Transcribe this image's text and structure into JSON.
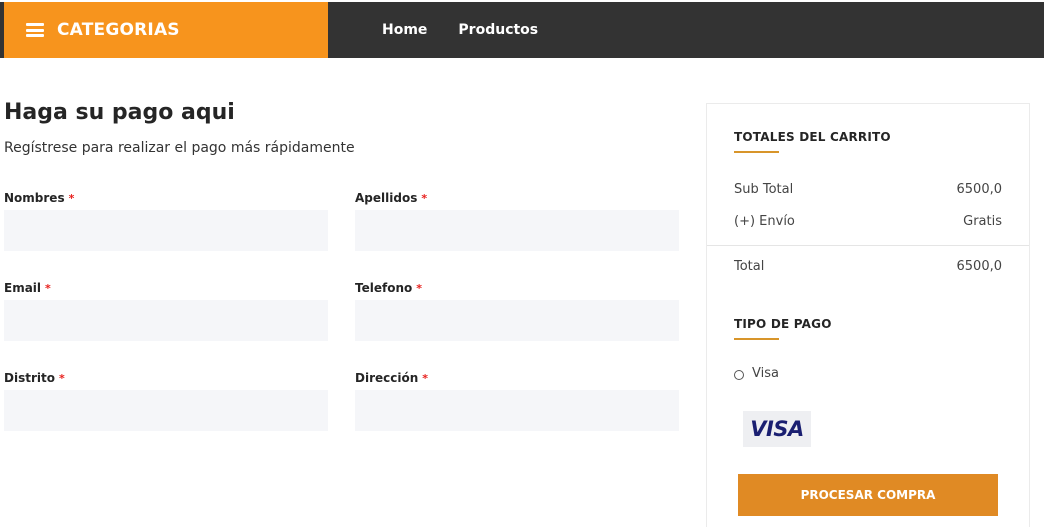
{
  "header": {
    "categories_label": "CATEGORIAS",
    "nav": [
      {
        "label": "Home"
      },
      {
        "label": "Productos"
      }
    ]
  },
  "checkout": {
    "title": "Haga su pago aqui",
    "subtitle": "Regístrese para realizar el pago más rápidamente",
    "required_mark": "*",
    "fields": [
      {
        "label": "Nombres",
        "value": "",
        "placeholder": ""
      },
      {
        "label": "Apellidos",
        "value": "",
        "placeholder": ""
      },
      {
        "label": "Email",
        "value": "",
        "placeholder": ""
      },
      {
        "label": "Telefono",
        "value": "",
        "placeholder": ""
      },
      {
        "label": "Distrito",
        "value": "",
        "placeholder": ""
      },
      {
        "label": "Dirección",
        "value": "",
        "placeholder": ""
      }
    ]
  },
  "cart": {
    "totals_heading": "TOTALES DEL CARRITO",
    "rows": [
      {
        "label": "Sub Total",
        "value": "6500,0"
      },
      {
        "label": "(+) Envío",
        "value": "Gratis"
      },
      {
        "label": "Total",
        "value": "6500,0"
      }
    ],
    "payment_heading": "TIPO DE PAGO",
    "payment_option": {
      "label": "Visa",
      "selected": false
    },
    "card_logo": "VISA",
    "submit_label": "PROCESAR COMPRA"
  },
  "colors": {
    "accent_orange": "#f7941d",
    "button_orange": "#e08a24",
    "header_dark": "#333333",
    "required_red": "#e8201d",
    "input_bg": "#f5f6f9"
  },
  "icons": {
    "menu": "hamburger-icon",
    "radio": "radio-unchecked-icon",
    "visa": "visa-logo"
  }
}
